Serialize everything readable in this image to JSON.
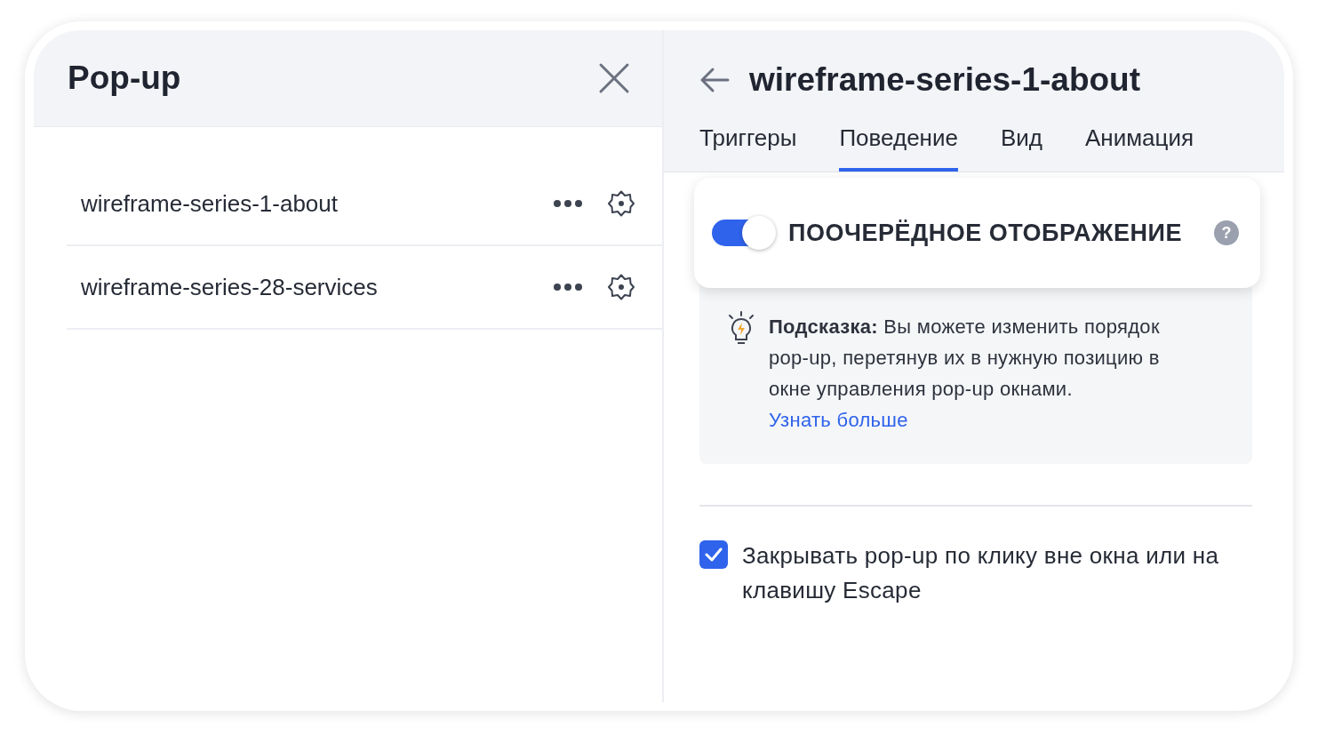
{
  "left_panel": {
    "title": "Pop-up",
    "items": [
      {
        "label": "wireframe-series-1-about"
      },
      {
        "label": "wireframe-series-28-services"
      }
    ]
  },
  "right_panel": {
    "title": "wireframe-series-1-about",
    "tabs": [
      {
        "label": "Триггеры",
        "selected": false
      },
      {
        "label": "Поведение",
        "selected": true
      },
      {
        "label": "Вид",
        "selected": false
      },
      {
        "label": "Анимация",
        "selected": false
      }
    ],
    "sequential_display": {
      "label": "ПООЧЕРЁДНОЕ ОТОБРАЖЕНИЕ",
      "on": true,
      "help": "?"
    },
    "tip": {
      "text": "**Подсказка:** Вы можете изменить порядок pop-up, перетянув их в нужную позицию в окне управления pop-up окнами.",
      "link": "Узнать больше"
    },
    "close_on_outside": {
      "label": "Закрывать pop-up по клику вне окна или на клавишу Escape",
      "checked": true
    }
  }
}
